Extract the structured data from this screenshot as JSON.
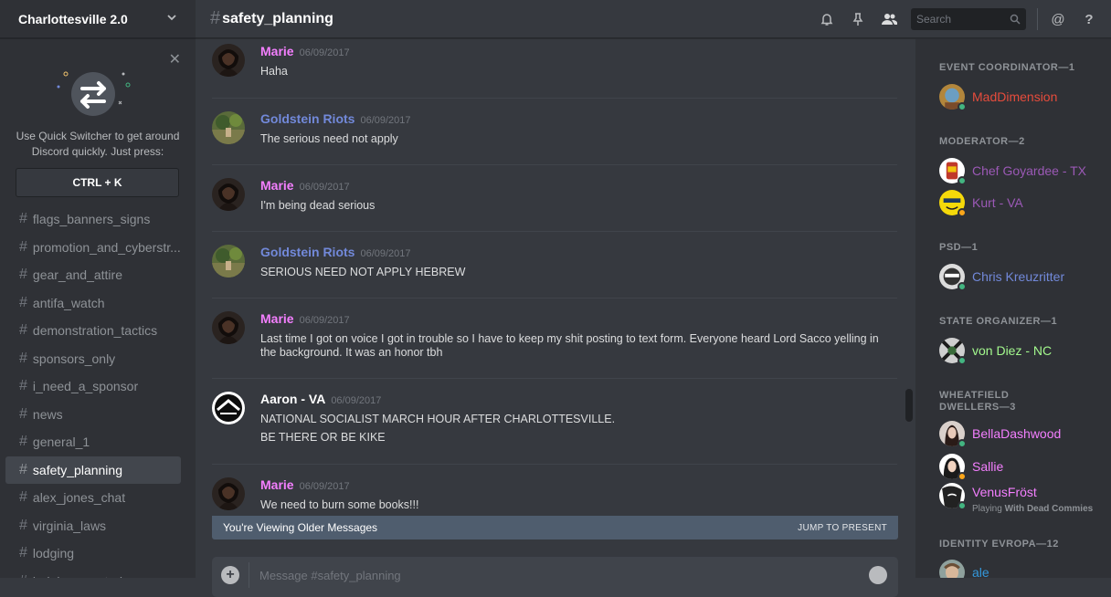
{
  "server": {
    "name": "Charlottesville 2.0"
  },
  "quick_switcher": {
    "tip": "Use Quick Switcher to get around Discord quickly. Just press:",
    "shortcut": "CTRL + K"
  },
  "channels": [
    {
      "name": "flags_banners_signs",
      "active": false
    },
    {
      "name": "promotion_and_cyberstr...",
      "active": false
    },
    {
      "name": "gear_and_attire",
      "active": false
    },
    {
      "name": "antifa_watch",
      "active": false
    },
    {
      "name": "demonstration_tactics",
      "active": false
    },
    {
      "name": "sponsors_only",
      "active": false
    },
    {
      "name": "i_need_a_sponsor",
      "active": false
    },
    {
      "name": "news",
      "active": false
    },
    {
      "name": "general_1",
      "active": false
    },
    {
      "name": "safety_planning",
      "active": true
    },
    {
      "name": "alex_jones_chat",
      "active": false
    },
    {
      "name": "virginia_laws",
      "active": false
    },
    {
      "name": "lodging",
      "active": false
    },
    {
      "name": "lodging_wanted",
      "active": false
    }
  ],
  "header": {
    "channel_title": "safety_planning",
    "search_placeholder": "Search",
    "icons": [
      "bell-icon",
      "pin-icon",
      "members-icon",
      "search-icon",
      "mention-icon",
      "help-icon"
    ]
  },
  "messages": [
    {
      "author": "Marie",
      "color": "#f47fff",
      "time": "06/09/2017",
      "lines": [
        "Haha"
      ]
    },
    {
      "author": "Goldstein Riots",
      "color": "#7289da",
      "time": "06/09/2017",
      "lines": [
        "The serious need not apply"
      ]
    },
    {
      "author": "Marie",
      "color": "#f47fff",
      "time": "06/09/2017",
      "lines": [
        "I'm being dead serious"
      ]
    },
    {
      "author": "Goldstein Riots",
      "color": "#7289da",
      "time": "06/09/2017",
      "lines": [
        "SERIOUS NEED NOT APPLY HEBREW"
      ]
    },
    {
      "author": "Marie",
      "color": "#f47fff",
      "time": "06/09/2017",
      "lines": [
        "Last time I got on voice I got in trouble so I have to keep my shit posting to text form. Everyone heard Lord Sacco yelling in the background. It was an honor tbh"
      ]
    },
    {
      "author": "Aaron - VA",
      "color": "#ffffff",
      "time": "06/09/2017",
      "lines": [
        "NATIONAL SOCIALIST MARCH HOUR AFTER CHARLOTTESVILLE.",
        "BE THERE OR BE KIKE"
      ]
    },
    {
      "author": "Marie",
      "color": "#f47fff",
      "time": "06/09/2017",
      "lines": [
        "We need to burn some books!!!"
      ]
    }
  ],
  "older_banner": {
    "text": "You're Viewing Older Messages",
    "jump": "JUMP TO PRESENT"
  },
  "composer": {
    "placeholder": "Message #safety_planning"
  },
  "member_groups": [
    {
      "title": "EVENT COORDINATOR—1",
      "members": [
        {
          "name": "MadDimension",
          "color": "#e74c3c",
          "status": "#43b581"
        }
      ]
    },
    {
      "title": "MODERATOR—2",
      "members": [
        {
          "name": "Chef Goyardee - TX",
          "color": "#9b59b6",
          "status": "#43b581"
        },
        {
          "name": "Kurt - VA",
          "color": "#9b59b6",
          "status": "#faa61a"
        }
      ]
    },
    {
      "title": "PSD—1",
      "members": [
        {
          "name": "Chris Kreuzritter",
          "color": "#7289da",
          "status": "#43b581"
        }
      ]
    },
    {
      "title": "STATE ORGANIZER—1",
      "members": [
        {
          "name": "von Diez - NC",
          "color": "#a3f88d",
          "status": "#43b581"
        }
      ]
    },
    {
      "title": "WHEATFIELD DWELLERS—3",
      "members": [
        {
          "name": "BellaDashwood",
          "color": "#f47fff",
          "status": "#43b581"
        },
        {
          "name": "Sallie",
          "color": "#f47fff",
          "status": "#faa61a"
        },
        {
          "name": "VenusFröst",
          "color": "#f47fff",
          "status": "#43b581",
          "playing_prefix": "Playing",
          "playing": "With Dead Commies"
        }
      ]
    },
    {
      "title": "IDENTITY EVROPA—12",
      "members": [
        {
          "name": "ale",
          "color": "#3498db",
          "status": "#43b581"
        }
      ]
    }
  ]
}
